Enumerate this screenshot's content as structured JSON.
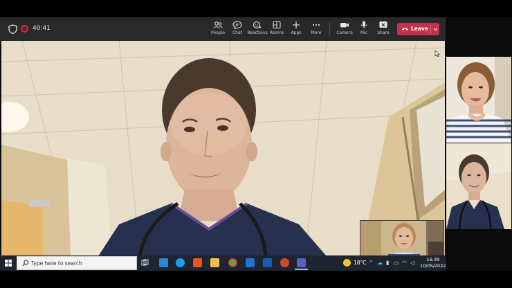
{
  "meeting": {
    "timer": "40:41",
    "toolbar": [
      {
        "label": "People",
        "icon": "people-icon"
      },
      {
        "label": "Chat",
        "icon": "chat-icon"
      },
      {
        "label": "Reactions",
        "icon": "reactions-icon"
      },
      {
        "label": "Rooms",
        "icon": "rooms-icon"
      },
      {
        "label": "Apps",
        "icon": "apps-icon"
      },
      {
        "label": "More",
        "icon": "more-icon"
      }
    ],
    "devices": [
      {
        "label": "Camera",
        "icon": "camera-icon"
      },
      {
        "label": "Mic",
        "icon": "mic-icon"
      },
      {
        "label": "Share",
        "icon": "share-icon"
      }
    ],
    "leave_label": "Leave",
    "accent": "#c4314b"
  },
  "taskbar": {
    "search_placeholder": "Type here to search",
    "temperature": "18°C",
    "time": "16:39",
    "date": "10/05/2022"
  }
}
